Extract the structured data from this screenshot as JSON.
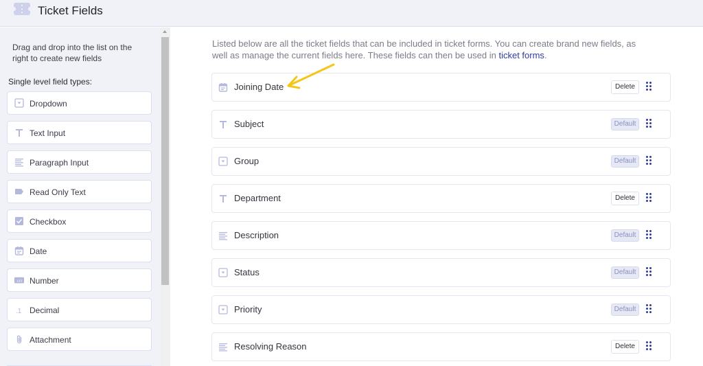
{
  "header": {
    "title": "Ticket Fields",
    "icon": "ticket-icon"
  },
  "sidebar": {
    "hint": "Drag and drop into the list on the right to create new fields",
    "heading": "Single level field types:",
    "field_types": [
      {
        "label": "Dropdown",
        "icon": "dropdown-icon"
      },
      {
        "label": "Text Input",
        "icon": "text-icon"
      },
      {
        "label": "Paragraph Input",
        "icon": "paragraph-icon"
      },
      {
        "label": "Read Only Text",
        "icon": "label-tag-icon"
      },
      {
        "label": "Checkbox",
        "icon": "checkbox-icon"
      },
      {
        "label": "Date",
        "icon": "calendar-icon"
      },
      {
        "label": "Number",
        "icon": "number-icon"
      },
      {
        "label": "Decimal",
        "icon": "decimal-icon"
      },
      {
        "label": "Attachment",
        "icon": "paperclip-icon"
      }
    ]
  },
  "main": {
    "intro_text": "Listed below are all the ticket fields that can be included in ticket forms. You can create brand new fields, as well as manage the current fields here. These fields can then be used in ",
    "intro_link": "ticket forms",
    "intro_end": ".",
    "fields": [
      {
        "label": "Joining Date",
        "icon": "calendar-icon",
        "action": "Delete"
      },
      {
        "label": "Subject",
        "icon": "text-icon",
        "action": "Default"
      },
      {
        "label": "Group",
        "icon": "dropdown-icon",
        "action": "Default"
      },
      {
        "label": "Department",
        "icon": "text-icon",
        "action": "Delete"
      },
      {
        "label": "Description",
        "icon": "paragraph-icon",
        "action": "Default"
      },
      {
        "label": "Status",
        "icon": "dropdown-icon",
        "action": "Default"
      },
      {
        "label": "Priority",
        "icon": "dropdown-icon",
        "action": "Default"
      },
      {
        "label": "Resolving Reason",
        "icon": "paragraph-icon",
        "action": "Delete"
      }
    ]
  },
  "colors": {
    "accent": "#2d3a9e",
    "icon": "#b3b8dc",
    "annotation_arrow": "#f5c518"
  }
}
